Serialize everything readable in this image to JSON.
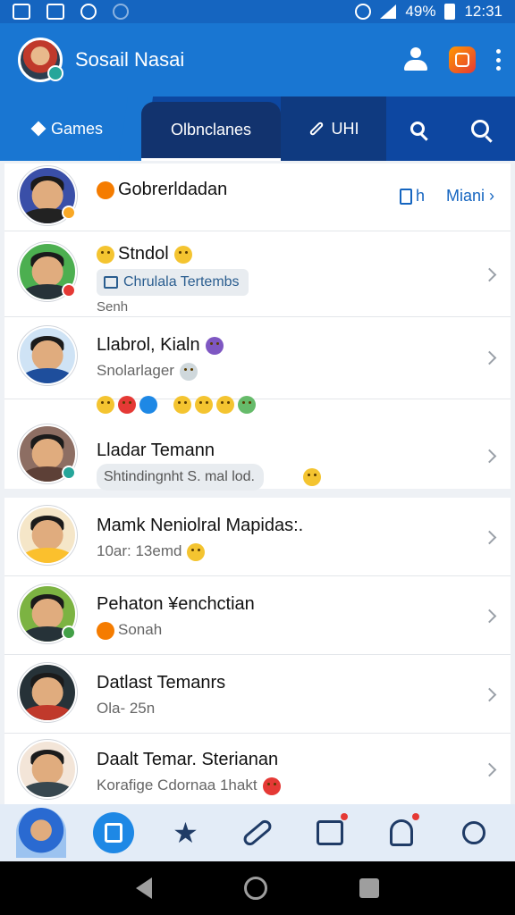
{
  "statusbar": {
    "time": "12:31",
    "battery": "49%",
    "icons": [
      "photo-icon",
      "photo-icon",
      "sync-icon",
      "notification-icon",
      "wifi-icon",
      "signal-icon",
      "battery-icon"
    ]
  },
  "app": {
    "title": "Sosail Nasai",
    "header_icons": [
      "person-icon",
      "instagram-icon",
      "more-icon"
    ]
  },
  "tabs": [
    {
      "label": "Games",
      "icon": "diamond-icon"
    },
    {
      "label": "Olbnclanes"
    },
    {
      "label": "UHI",
      "icon": "pen-icon"
    },
    {
      "icon": "search-add-icon"
    },
    {
      "icon": "search-icon"
    }
  ],
  "list1": [
    {
      "name": "Gobrerldadan",
      "action_left": "h",
      "action_right": "Miani ›"
    },
    {
      "name": "Stndol",
      "pill": "Chrulala Tertembs",
      "sub": "Senh"
    },
    {
      "name": "Llabrol, Kialn",
      "sub": "Snolarlager"
    },
    {
      "name": "Lladar Temann",
      "pill": "Shtindingnht S. mal lod."
    }
  ],
  "list2": [
    {
      "name": "Mamk Neniolral Mapidas:.",
      "sub": "10ar: 13emd"
    },
    {
      "name": "Pehaton ¥enchctian",
      "sub": "Sonah"
    },
    {
      "name": "Datlast Temanrs",
      "sub": "Ola- 25n"
    },
    {
      "name": "Daalt Temar. Sterianan",
      "sub": "Korafige Cdornaa 1hakt"
    }
  ],
  "bottom_nav": [
    "profile-avatar",
    "home-icon",
    "star-icon",
    "edit-icon",
    "calendar-icon",
    "person-icon",
    "settings-icon"
  ],
  "colors": {
    "primary": "#1976d2",
    "dark": "#0d47a1",
    "accent": "#f57c00"
  }
}
